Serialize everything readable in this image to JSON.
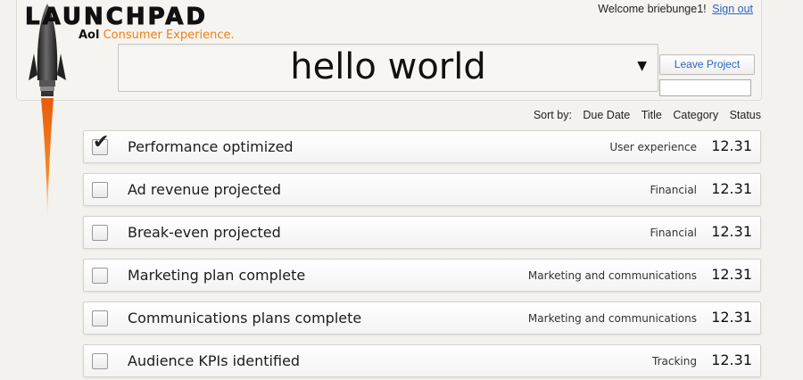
{
  "brand": {
    "title": "LAUNCHPAD",
    "sub_brand": "Aol",
    "sub_tagline": "Consumer Experience."
  },
  "user": {
    "welcome": "Welcome briebunge1!",
    "sign_out": "Sign out"
  },
  "project": {
    "name": "hello world",
    "arrow": "▼",
    "leave_label": "Leave Project",
    "input_value": ""
  },
  "sort": {
    "label": "Sort by:",
    "options": [
      "Due Date",
      "Title",
      "Category",
      "Status"
    ]
  },
  "tasks": [
    {
      "title": "Performance optimized",
      "category": "User experience",
      "date": "12.31",
      "checked": true
    },
    {
      "title": "Ad revenue projected",
      "category": "Financial",
      "date": "12.31",
      "checked": false
    },
    {
      "title": "Break-even projected",
      "category": "Financial",
      "date": "12.31",
      "checked": false
    },
    {
      "title": "Marketing plan complete",
      "category": "Marketing and communications",
      "date": "12.31",
      "checked": false
    },
    {
      "title": "Communications plans complete",
      "category": "Marketing and communications",
      "date": "12.31",
      "checked": false
    },
    {
      "title": "Audience KPIs identified",
      "category": "Tracking",
      "date": "12.31",
      "checked": false
    }
  ],
  "colors": {
    "accent_orange": "#f07f12",
    "link_blue": "#2b63c6",
    "background": "#f4f2ef"
  },
  "icons": {
    "rocket": "rocket-icon",
    "check": "checkmark-icon",
    "dropdown": "dropdown-arrow-icon"
  }
}
